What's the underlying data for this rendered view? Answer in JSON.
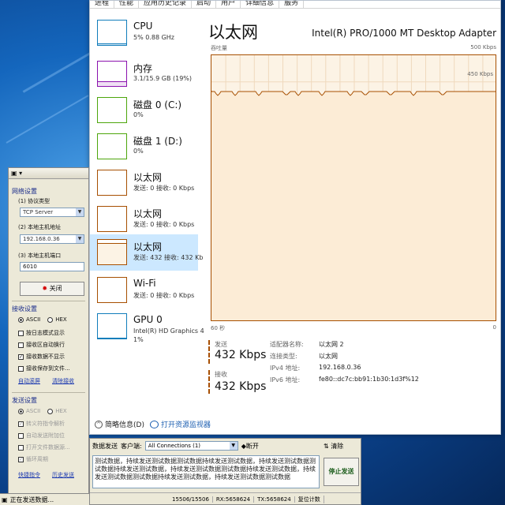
{
  "taskmgr": {
    "tabs": [
      "进程",
      "性能",
      "应用历史记录",
      "启动",
      "用户",
      "详细信息",
      "服务"
    ],
    "resources": [
      {
        "name": "CPU",
        "sub": "5% 0.88 GHz",
        "sub2": "",
        "kind": "cpu",
        "fill_pct": 5
      },
      {
        "name": "内存",
        "sub": "3.1/15.9 GB (19%)",
        "sub2": "",
        "kind": "mem",
        "fill_pct": 19
      },
      {
        "name": "磁盘 0 (C:)",
        "sub": "0%",
        "sub2": "",
        "kind": "disk",
        "fill_pct": 0
      },
      {
        "name": "磁盘 1 (D:)",
        "sub": "0%",
        "sub2": "",
        "kind": "disk",
        "fill_pct": 0
      },
      {
        "name": "以太网",
        "sub": "发送: 0 接收: 0 Kbps",
        "sub2": "",
        "kind": "eth",
        "fill_pct": 0
      },
      {
        "name": "以太网",
        "sub": "发送: 0 接收: 0 Kbps",
        "sub2": "",
        "kind": "eth",
        "fill_pct": 0
      },
      {
        "name": "以太网",
        "sub": "发送: 432 接收: 432 Kb",
        "sub2": "",
        "kind": "eth",
        "fill_pct": 86,
        "selected": true
      },
      {
        "name": "Wi-Fi",
        "sub": "发送: 0 接收: 0 Kbps",
        "sub2": "",
        "kind": "eth",
        "fill_pct": 0
      },
      {
        "name": "GPU 0",
        "sub": "Intel(R) HD Graphics 4",
        "sub2": "1%",
        "kind": "gpu",
        "fill_pct": 1
      }
    ],
    "detail": {
      "title": "以太网",
      "adapter": "Intel(R) PRO/1000 MT Desktop Adapter",
      "throughput_label": "吞吐量",
      "max_label": "500 Kbps",
      "line_label": "450 Kbps",
      "time_left": "60 秒",
      "time_right": "0"
    },
    "stats": {
      "send_label": "发送",
      "send_value": "432 Kbps",
      "recv_label": "接收",
      "recv_value": "432 Kbps",
      "props": [
        {
          "label": "适配器名称:",
          "value": "以太网 2"
        },
        {
          "label": "连接类型:",
          "value": "以太网"
        },
        {
          "label": "IPv4 地址:",
          "value": "192.168.0.36"
        },
        {
          "label": "IPv6 地址:",
          "value": "fe80::dc7c:bb91:1b30:1d3f%12"
        }
      ]
    },
    "footer": {
      "fewer_details": "简略信息(D)",
      "open_monitor": "打开资源监视器"
    }
  },
  "nettool": {
    "network_settings": "网络设置",
    "protocol_label": "(1) 协议类型",
    "protocol_value": "TCP Server",
    "local_ip_label": "(2) 本地主机地址",
    "local_ip_value": "192.168.0.36",
    "local_port_label": "(3) 本地主机端口",
    "local_port_value": "6010",
    "close_button": "关闭",
    "recv_settings": "接收设置",
    "ascii": "ASCII",
    "hex": "HEX",
    "recv_opts": [
      "按日志模式显示",
      "接收区自动换行",
      "接收数据不显示",
      "接收保存到文件..."
    ],
    "auto_clear": "自动滚屏",
    "clear_recv": "清除接收",
    "send_settings": "发送设置",
    "send_opts": [
      "转义符指令解析",
      "自动发送附加位",
      "打开文件数据源...",
      "循环周期"
    ],
    "shortcut": "快捷指令",
    "history": "历史发送",
    "status_text": "正在发送数据..."
  },
  "sendarea": {
    "data_send_label": "数据发送",
    "client_label": "客户端:",
    "client_value": "All Connections (1)",
    "disconnect": "断开",
    "clear": "清除",
    "send_button": "停止发送",
    "text": "测试数据，持续发送测试数据测试数据持续发送测试数据，持续发送测试数据测试数据持续发送测试数据，持续发送测试数据测试数据持续发送测试数据，持续发送测试数据测试数据持续发送测试数据，持续发送测试数据测试数据",
    "status": [
      "15506/15506",
      "RX:5658624",
      "TX:5658624",
      "复位计数"
    ]
  },
  "colors": {
    "eth_line": "#a74f01",
    "graph_bg": "#fcf3e5",
    "selected_bg": "#cce8ff"
  }
}
